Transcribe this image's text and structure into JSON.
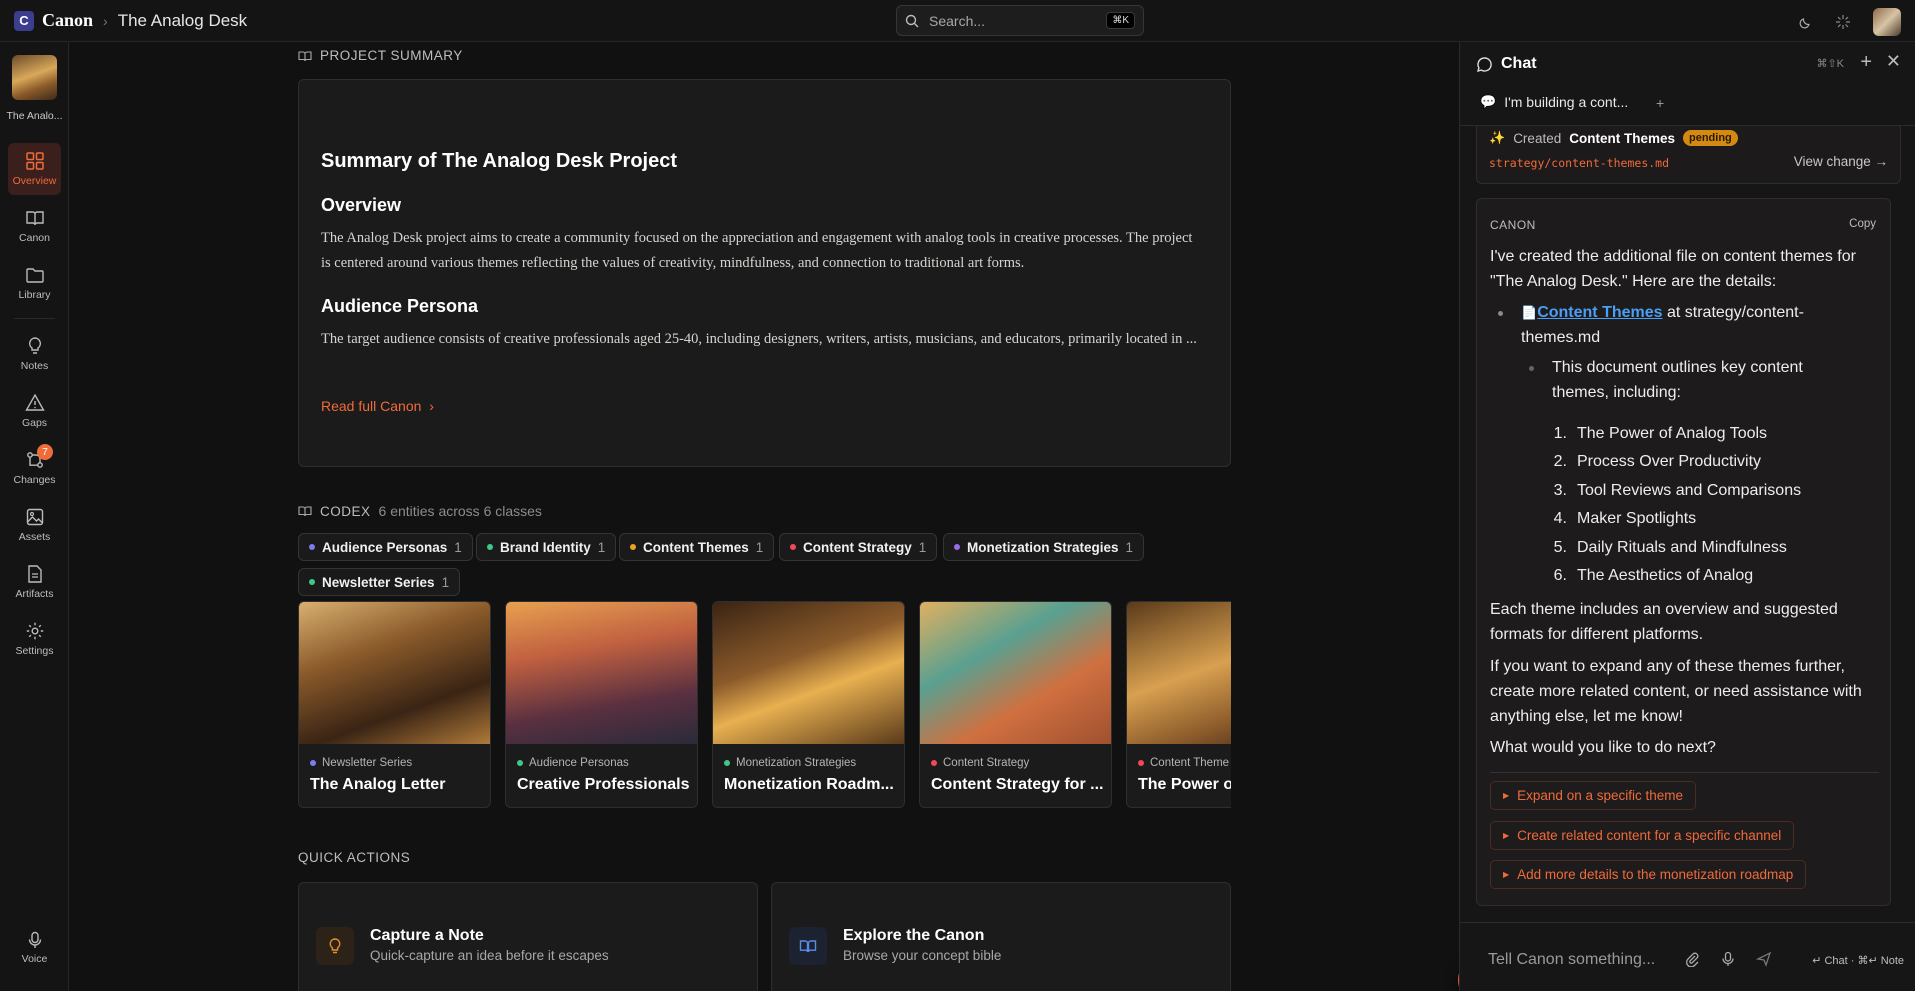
{
  "topbar": {
    "brand": "Canon",
    "logo_letter": "C",
    "breadcrumb_project": "The Analog Desk",
    "search_placeholder": "Search...",
    "search_shortcut": "⌘K"
  },
  "leftnav": {
    "project_name": "The Analo...",
    "items": [
      {
        "label": "Overview",
        "icon": "grid-icon"
      },
      {
        "label": "Canon",
        "icon": "book-icon"
      },
      {
        "label": "Library",
        "icon": "folder-icon"
      },
      {
        "label": "Notes",
        "icon": "lightbulb-icon"
      },
      {
        "label": "Gaps",
        "icon": "warning-icon"
      },
      {
        "label": "Changes",
        "icon": "git-branch-icon",
        "badge": "7"
      },
      {
        "label": "Assets",
        "icon": "image-icon"
      },
      {
        "label": "Artifacts",
        "icon": "document-icon"
      },
      {
        "label": "Settings",
        "icon": "gear-icon"
      }
    ],
    "voice_label": "Voice"
  },
  "summary": {
    "section_label": "PROJECT SUMMARY",
    "title": "Summary of The Analog Desk Project",
    "overview_heading": "Overview",
    "overview_text": "The Analog Desk project aims to create a community focused on the appreciation and engagement with analog tools in creative processes. The project is centered around various themes reflecting the values of creativity, mindfulness, and connection to traditional art forms.",
    "persona_heading": "Audience Persona",
    "persona_text": "The target audience consists of creative professionals aged 25-40, including designers, writers, artists, musicians, and educators, primarily located in ...",
    "read_full": "Read full Canon"
  },
  "codex": {
    "section_label": "CODEX",
    "subtitle": "6 entities across 6 classes",
    "chips": [
      {
        "label": "Audience Personas",
        "count": "1",
        "color": "#7c7cf0"
      },
      {
        "label": "Brand Identity",
        "count": "1",
        "color": "#3ec98a"
      },
      {
        "label": "Content Themes",
        "count": "1",
        "color": "#f0a020"
      },
      {
        "label": "Content Strategy",
        "count": "1",
        "color": "#f04a5a"
      },
      {
        "label": "Monetization Strategies",
        "count": "1",
        "color": "#9a6af0"
      },
      {
        "label": "Newsletter Series",
        "count": "1",
        "color": "#3ec98a"
      }
    ],
    "cards": [
      {
        "class": "Newsletter Series",
        "title": "The Analog Letter",
        "color": "#7c7cf0"
      },
      {
        "class": "Audience Personas",
        "title": "Creative Professionals",
        "color": "#3ec98a"
      },
      {
        "class": "Monetization Strategies",
        "title": "Monetization Roadm...",
        "color": "#3ec98a"
      },
      {
        "class": "Content Strategy",
        "title": "Content Strategy for ...",
        "color": "#f04a5a"
      },
      {
        "class": "Content Theme",
        "title": "The Power of",
        "color": "#f04a5a"
      }
    ]
  },
  "quick_actions": {
    "section_label": "QUICK ACTIONS",
    "items": [
      {
        "title": "Capture a Note",
        "subtitle": "Quick-capture an idea before it escapes"
      },
      {
        "title": "Explore the Canon",
        "subtitle": "Browse your concept bible"
      }
    ]
  },
  "chat": {
    "title": "Chat",
    "shortcut": "⌘⇧K",
    "tab_label": "I'm building a cont...",
    "created": {
      "prefix": "Created",
      "name": "Content Themes",
      "status": "pending",
      "path": "strategy/content-themes.md",
      "view_change": "View change →"
    },
    "message": {
      "sender": "CANON",
      "copy": "Copy",
      "intro": "I've created the additional file on content themes for \"The Analog Desk.\" Here are the details:",
      "file_link": "Content Themes",
      "file_loc": " at strategy/content-themes.md",
      "sub_bullet": "This document outlines key content themes, including:",
      "themes": [
        "The Power of Analog Tools",
        "Process Over Productivity",
        "Tool Reviews and Comparisons",
        "Maker Spotlights",
        "Daily Rituals and Mindfulness",
        "The Aesthetics of Analog"
      ],
      "para1": "Each theme includes an overview and suggested formats for different platforms.",
      "para2": "If you want to expand any of these themes further, create more related content, or need assistance with anything else, let me know!",
      "para3": "What would you like to do next?",
      "suggestions": [
        "Expand on a specific theme",
        "Create related content for a specific channel",
        "Add more details to the monetization roadmap"
      ]
    },
    "input_placeholder": "Tell Canon something...",
    "hint": "↵ Chat · ⌘↵ Note"
  }
}
